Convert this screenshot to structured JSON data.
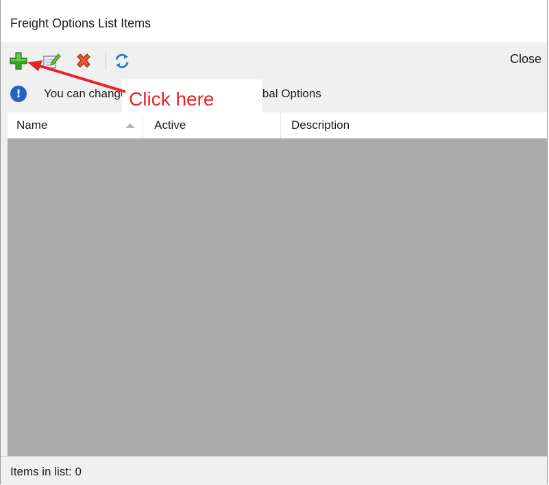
{
  "window": {
    "title": "Freight Options List Items"
  },
  "toolbar": {
    "add": "add-icon",
    "edit": "edit-icon",
    "delete": "delete-icon",
    "refresh": "refresh-icon",
    "close_label": "Close"
  },
  "info": {
    "icon": "info-icon",
    "text": "You can change the order of this list in Global Options"
  },
  "grid": {
    "columns": [
      "Name",
      "Active",
      "Description"
    ],
    "sort_icon": "sort-ascending-icon",
    "rows": []
  },
  "status": {
    "text": "Items in list: 0"
  },
  "annotation": {
    "text": "Click here",
    "color": "#e8232a"
  }
}
